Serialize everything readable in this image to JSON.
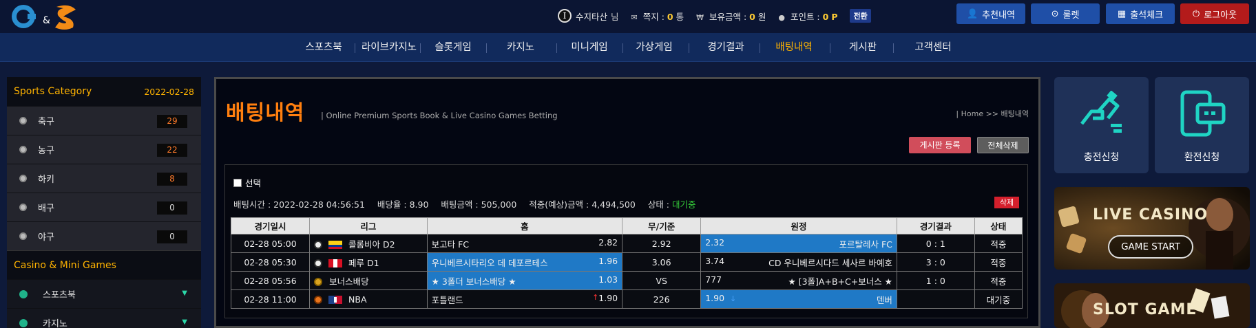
{
  "header": {
    "logo_text": "G&S",
    "user_badge": "I",
    "username": "수지타산",
    "username_suffix": "님",
    "messages_label": "쪽지 :",
    "messages_count": "0",
    "messages_unit": "통",
    "balance_label": "보유금액 :",
    "balance_value": "0",
    "balance_unit": "원",
    "points_label": "포인트 :",
    "points_value": "0",
    "points_unit": "P",
    "switch_label": "전환",
    "buttons": {
      "referral": "추천내역",
      "roulette": "룰렛",
      "attendance": "출석체크",
      "logout": "로그아웃"
    }
  },
  "nav": {
    "items": [
      "스포츠북",
      "라이브카지노",
      "슬롯게임",
      "카지노",
      "미니게임",
      "가상게임",
      "경기결과",
      "배팅내역",
      "게시판",
      "고객센터"
    ],
    "active": "배팅내역"
  },
  "sidebar": {
    "title": "Sports Category",
    "date": "2022-02-28",
    "sports": [
      {
        "label": "축구",
        "count": "29"
      },
      {
        "label": "농구",
        "count": "22"
      },
      {
        "label": "하키",
        "count": "8"
      },
      {
        "label": "배구",
        "count": "0"
      },
      {
        "label": "야구",
        "count": "0"
      }
    ],
    "casino_title": "Casino & Mini Games",
    "casino_items": [
      {
        "label": "스포츠북"
      },
      {
        "label": "카지노"
      }
    ]
  },
  "main": {
    "title": "배팅내역",
    "subtitle": "|  Online Premium Sports Book & Live Casino Games Betting",
    "breadcrumb": "| Home >> 배팅내역",
    "btn_board": "게시판 등록",
    "btn_delete_all": "전체삭제",
    "select_label": "선택",
    "bet_info": {
      "time": "배팅시간 : 2022-02-28 04:56:51",
      "rate": "배당율 : 8.90",
      "amount": "배팅금액 : 505,000",
      "expected": "적중(예상)금액 : 4,494,500",
      "status_label": "상태 :",
      "status_value": "대기중"
    },
    "btn_delete": "삭제",
    "table": {
      "headers": [
        "경기일시",
        "리그",
        "홈",
        "무/기준",
        "원정",
        "경기결과",
        "상태"
      ],
      "rows": [
        {
          "datetime": "02-28 05:00",
          "league": "콜롬비아 D2",
          "home": "보고타 FC",
          "home_odds": "2.82",
          "draw": "2.92",
          "away": "포르탈레사 FC",
          "away_odds": "2.32",
          "result": "0 : 1",
          "status": "적중"
        },
        {
          "datetime": "02-28 05:30",
          "league": "페루 D1",
          "home": "우니베르시타리오 데 데포르테스",
          "home_odds": "1.96",
          "draw": "3.06",
          "away": "CD 우니베르시다드 세사르 바예호",
          "away_odds": "3.74",
          "result": "3 : 0",
          "status": "적중"
        },
        {
          "datetime": "02-28 05:56",
          "league": "보너스배당",
          "home": "★ 3폴더 보너스배당 ★",
          "home_odds": "1.03",
          "draw": "VS",
          "away": "★ [3폴]A+B+C+보너스 ★",
          "away_odds": "777",
          "result": "1 : 0",
          "status": "적중"
        },
        {
          "datetime": "02-28 11:00",
          "league": "NBA",
          "home": "포틀랜드",
          "home_odds": "1.90",
          "draw": "226",
          "away": "덴버",
          "away_odds": "1.90",
          "result": "",
          "status": "대기중"
        }
      ]
    }
  },
  "right": {
    "deposit_label": "충전신청",
    "withdraw_label": "환전신청",
    "live_casino_title": "LIVE CASINO",
    "live_casino_btn": "GAME START",
    "slot_title": "SLOT GAME"
  },
  "colors": {
    "accent_orange": "#ff7f0f",
    "active_nav": "#ffb300",
    "selected_cell": "#1f79c6",
    "status_green": "#35d03a",
    "status_blue": "#3aa3ff"
  }
}
